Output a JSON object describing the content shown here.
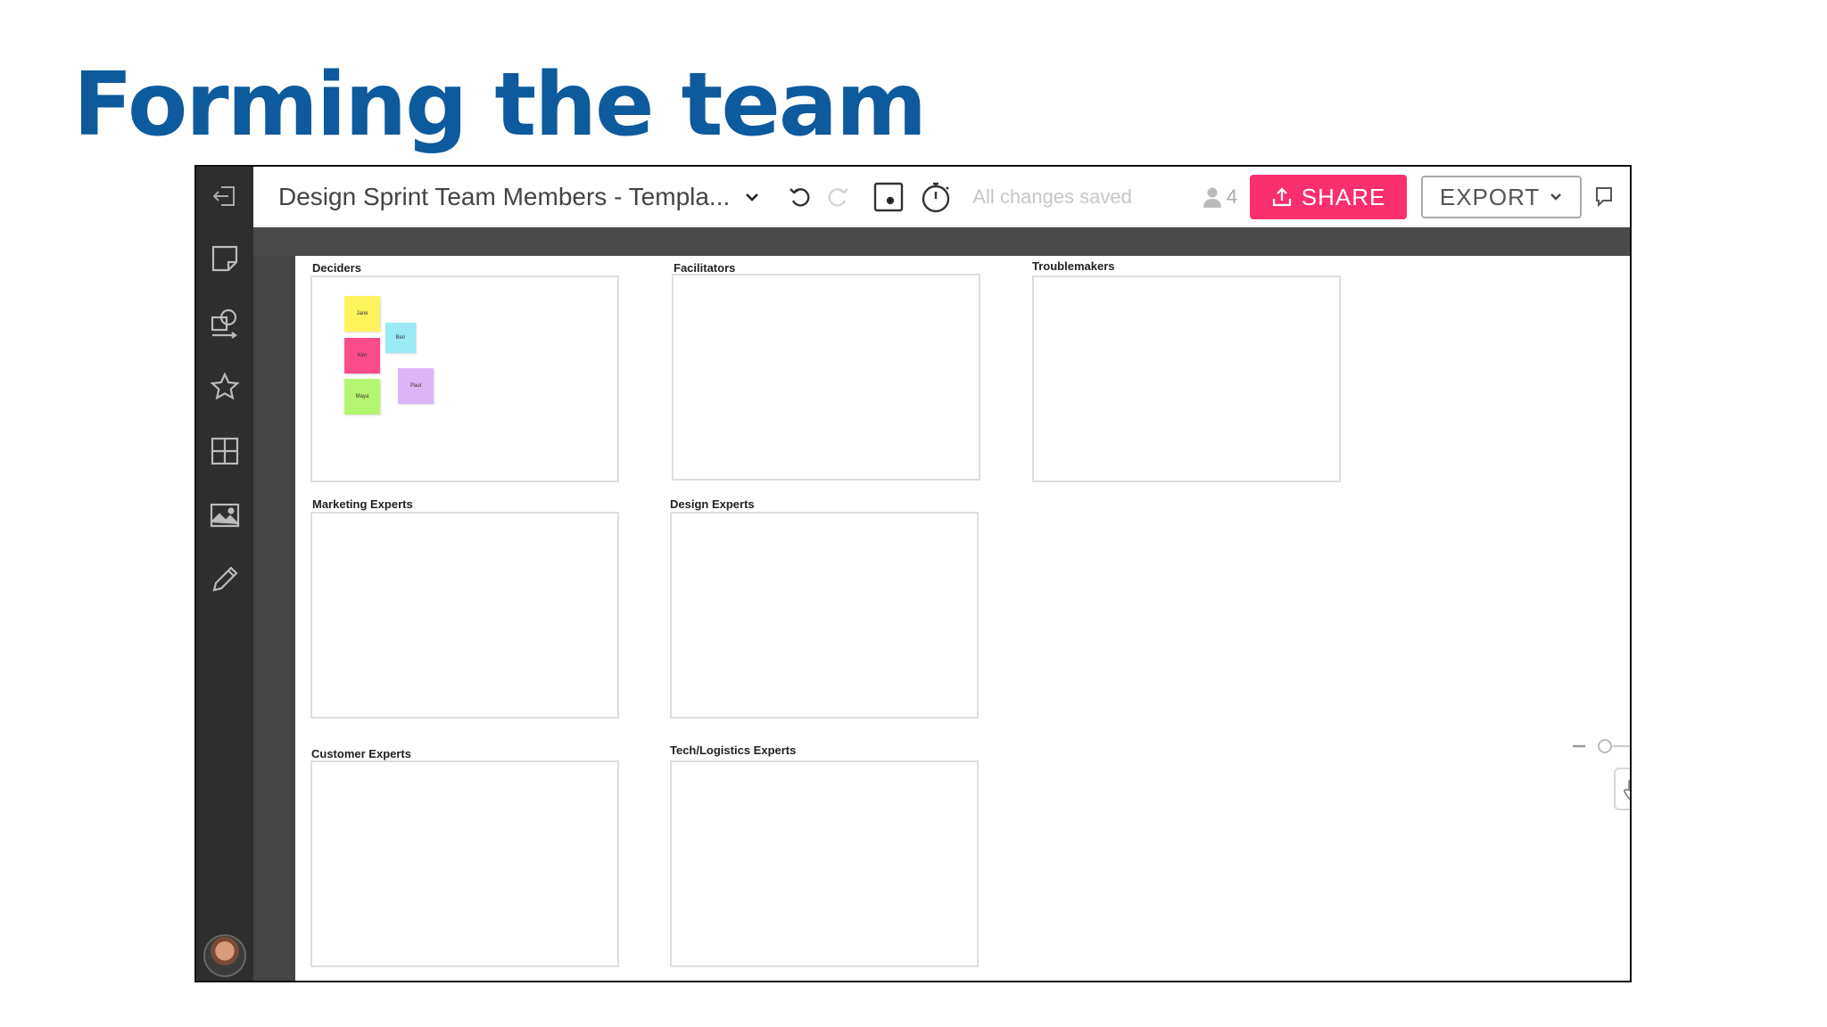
{
  "slide": {
    "title": "Forming the team"
  },
  "app": {
    "doc_title": "Design Sprint Team Members - Templa...",
    "status": "All changes saved",
    "collaborator_count": "4",
    "share_label": "SHARE",
    "export_label": "EXPORT",
    "settings_glyph": "Z",
    "accent_color": "#fa2f6e",
    "title_color": "#0d5a9c"
  },
  "sidebar": {
    "icons": [
      "exit-icon",
      "sticky-note-icon",
      "shapes-icon",
      "star-icon",
      "grid-icon",
      "image-icon",
      "pencil-icon"
    ]
  },
  "frames": [
    {
      "label": "Deciders"
    },
    {
      "label": "Facilitators"
    },
    {
      "label": "Troublemakers"
    },
    {
      "label": "Marketing Experts"
    },
    {
      "label": "Design Experts"
    },
    {
      "label": "Customer Experts"
    },
    {
      "label": "Tech/Logistics Experts"
    }
  ],
  "stickies": [
    {
      "text": "Jane",
      "color": "#fdf35d"
    },
    {
      "text": "Ben",
      "color": "#9aeaf7"
    },
    {
      "text": "Kim",
      "color": "#fa4c8a"
    },
    {
      "text": "Paul",
      "color": "#dcb5f7"
    },
    {
      "text": "Maya",
      "color": "#b4f571"
    }
  ]
}
